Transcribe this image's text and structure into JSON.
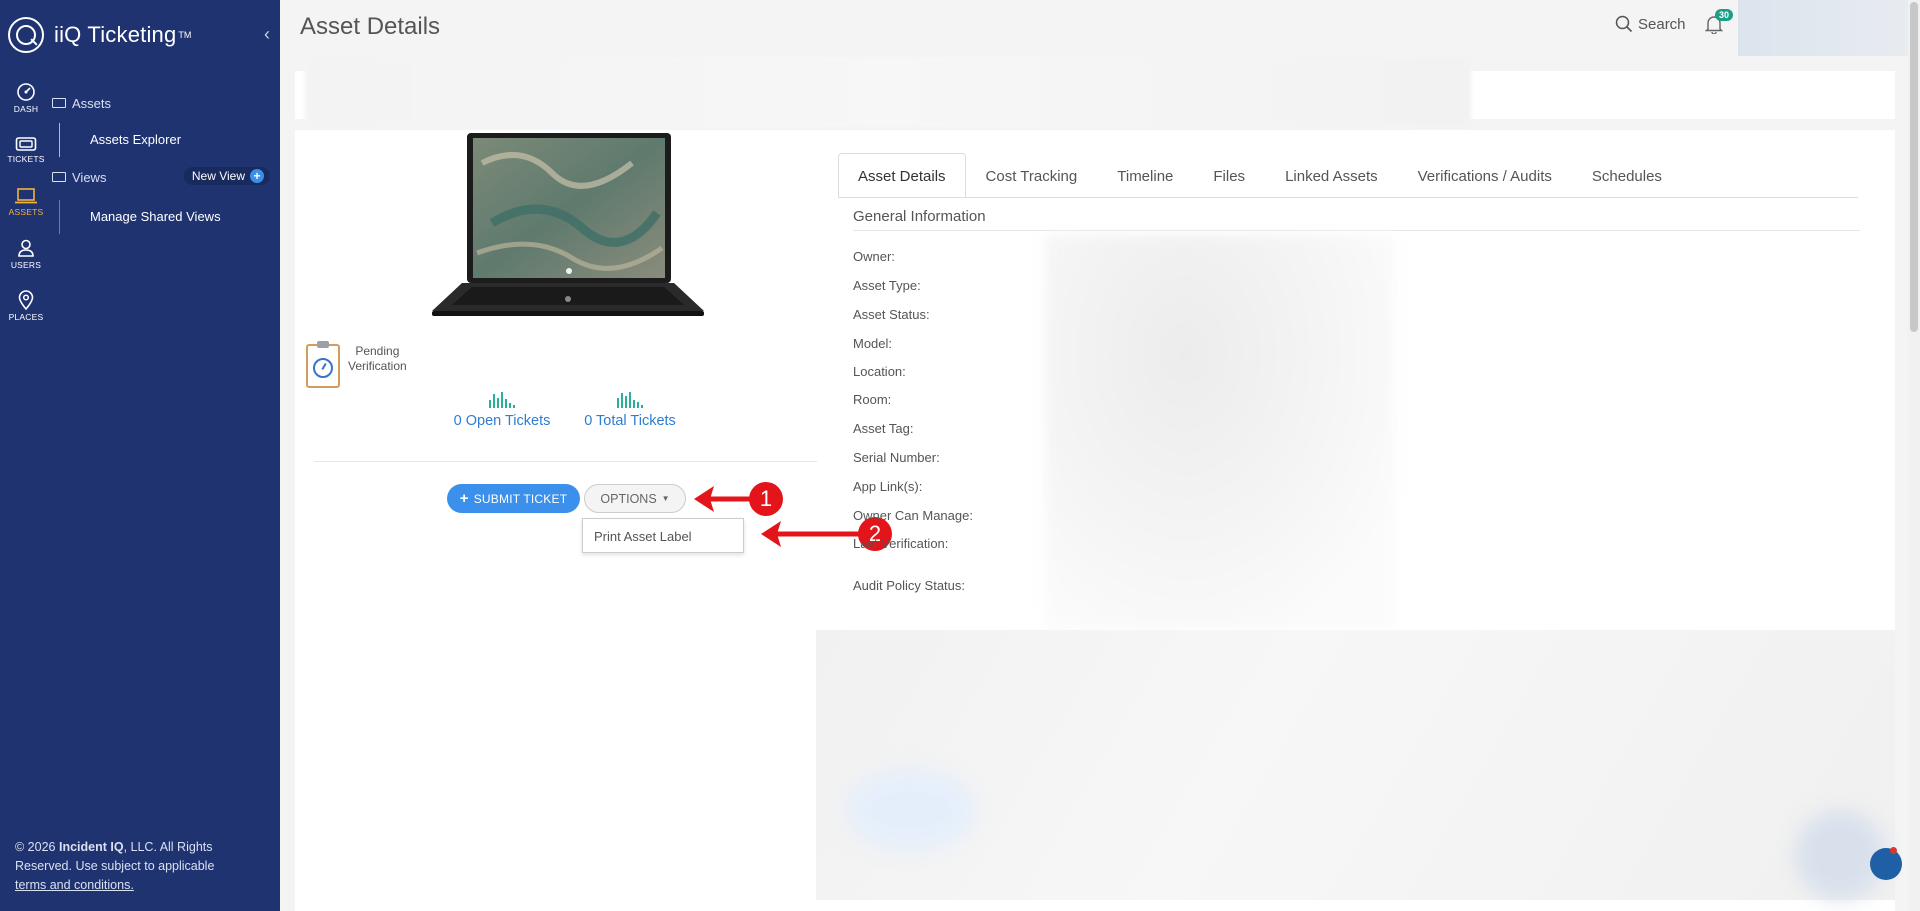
{
  "app": {
    "name": "iiQ Ticketing",
    "tm": "TM"
  },
  "rail": [
    {
      "id": "dash",
      "label": "DASH",
      "icon": "dashboard-icon"
    },
    {
      "id": "tickets",
      "label": "TICKETS",
      "icon": "ticket-icon"
    },
    {
      "id": "assets",
      "label": "ASSETS",
      "icon": "laptop-icon",
      "active": true
    },
    {
      "id": "users",
      "label": "USERS",
      "icon": "user-icon"
    },
    {
      "id": "places",
      "label": "PLACES",
      "icon": "map-pin-icon"
    }
  ],
  "nav": {
    "assets_section": "Assets",
    "assets_explorer": "Assets Explorer",
    "views_section": "Views",
    "new_view": "New View",
    "manage_shared_views": "Manage Shared Views"
  },
  "footer": {
    "line1_pre": "© 2026 ",
    "company": "Incident IQ",
    "line1_post": ", LLC. All Rights Reserved. Use subject to applicable ",
    "terms": "terms and conditions."
  },
  "header": {
    "title": "Asset Details",
    "search_label": "Search",
    "notification_count": "30"
  },
  "asset": {
    "status_line1": "Pending",
    "status_line2": "Verification",
    "open_tickets": "0 Open Tickets",
    "total_tickets": "0 Total Tickets"
  },
  "actions": {
    "submit_ticket": "SUBMIT TICKET",
    "options": "OPTIONS",
    "dropdown_items": [
      "Print Asset Label"
    ]
  },
  "annotations": {
    "callout1": "1",
    "callout2": "2",
    "color": "#e3151a"
  },
  "tabs": [
    "Asset Details",
    "Cost Tracking",
    "Timeline",
    "Files",
    "Linked Assets",
    "Verifications / Audits",
    "Schedules"
  ],
  "general_info": {
    "title": "General Information",
    "fields": [
      "Owner:",
      "Asset Type:",
      "Asset Status:",
      "Model:",
      "Location:",
      "Room:",
      "Asset Tag:",
      "Serial Number:",
      "App Link(s):",
      "Owner Can Manage:",
      "Last Verification:",
      "Audit Policy Status:"
    ]
  },
  "colors": {
    "sidebar": "#1f3371",
    "accent": "#f2b23e",
    "primary": "#3a90ea",
    "link": "#2f7dd1",
    "badge": "#1aa089"
  }
}
